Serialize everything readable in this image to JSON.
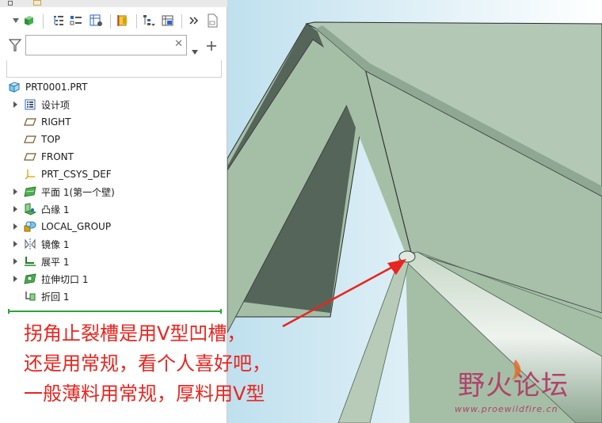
{
  "search": {
    "value": "",
    "placeholder": ""
  },
  "tree": {
    "root": "PRT0001.PRT",
    "items": [
      {
        "label": "设计项",
        "icon": "design-items-icon",
        "expandable": true
      },
      {
        "label": "RIGHT",
        "icon": "datum-plane-icon",
        "expandable": false
      },
      {
        "label": "TOP",
        "icon": "datum-plane-icon",
        "expandable": false
      },
      {
        "label": "FRONT",
        "icon": "datum-plane-icon",
        "expandable": false
      },
      {
        "label": "PRT_CSYS_DEF",
        "icon": "coordinate-system-icon",
        "expandable": false
      },
      {
        "label": "平面 1(第一个壁)",
        "icon": "planar-wall-icon",
        "expandable": true
      },
      {
        "label": "凸缘 1",
        "icon": "flange-icon",
        "expandable": true
      },
      {
        "label": "LOCAL_GROUP",
        "icon": "local-group-icon",
        "expandable": true
      },
      {
        "label": "镜像 1",
        "icon": "mirror-icon",
        "expandable": true
      },
      {
        "label": "展平 1",
        "icon": "unbend-icon",
        "expandable": true
      },
      {
        "label": "拉伸切口 1",
        "icon": "extrude-cut-icon",
        "expandable": true
      },
      {
        "label": "折回 1",
        "icon": "bend-back-icon",
        "expandable": false
      }
    ]
  },
  "callout": {
    "lines": [
      "拐角止裂槽是用V型凹槽，",
      "还是用常规，看个人喜好吧，",
      "一般薄料用常规，厚料用V型"
    ],
    "color": "#e8251f"
  },
  "watermark": {
    "title": "野火论坛",
    "url": "www.proewildfire.cn",
    "color": "#b0426a"
  },
  "colors": {
    "model_face": "#a5bfa7",
    "model_face_dark": "#56655a",
    "viewport_bg": "#bfe0ee",
    "accent_green": "#2ea33a"
  }
}
